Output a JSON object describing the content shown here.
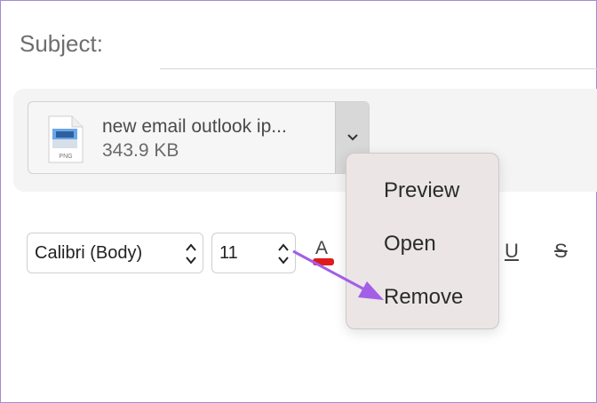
{
  "compose": {
    "subject_label": "Subject:"
  },
  "attachment": {
    "file_name": "new email outlook ip...",
    "file_size": "343.9 KB",
    "file_type_badge": "PNG",
    "icon": "png-file-icon",
    "menu_icon": "chevron-down-icon"
  },
  "toolbar": {
    "font_family": "Calibri (Body)",
    "font_size": "11",
    "font_color_letter": "A",
    "font_color": "#e01b1b",
    "underline_label": "U",
    "strikethrough_label": "S"
  },
  "context_menu": {
    "items": [
      {
        "label": "Preview"
      },
      {
        "label": "Open"
      },
      {
        "label": "Remove"
      }
    ]
  },
  "annotation": {
    "arrow_color": "#a35ee8",
    "points_to": "Remove"
  }
}
